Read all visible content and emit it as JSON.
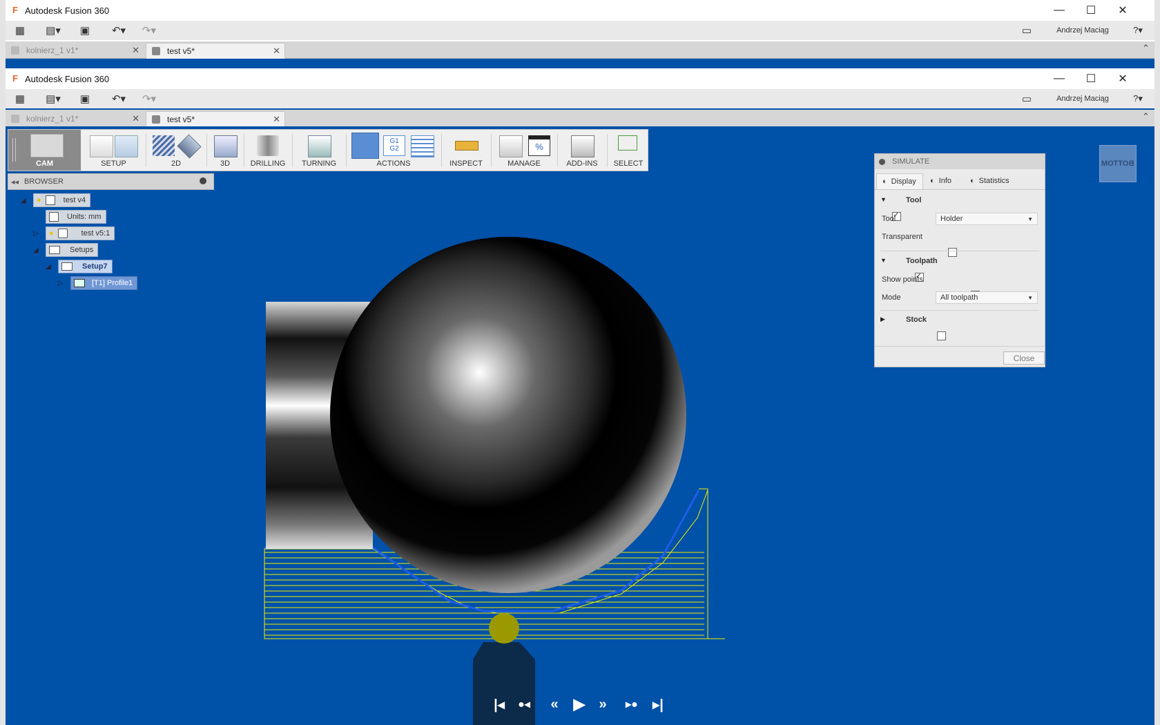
{
  "back_window": {
    "title": "Autodesk Fusion 360",
    "user": "Andrzej Maciąg",
    "tabs": [
      {
        "label": "kolnierz_1 v1*"
      },
      {
        "label": "test v5*"
      }
    ]
  },
  "front_window": {
    "title": "Autodesk Fusion 360",
    "user": "Andrzej Maciąg",
    "tabs": [
      {
        "label": "kolnierz_1 v1*"
      },
      {
        "label": "test v5*"
      }
    ]
  },
  "toolbar": {
    "workspace": "CAM",
    "groups": {
      "setup": "SETUP",
      "2d": "2D",
      "3d": "3D",
      "drilling": "DRILLING",
      "turning": "TURNING",
      "actions": "ACTIONS",
      "inspect": "INSPECT",
      "manage": "MANAGE",
      "addins": "ADD-INS",
      "select": "SELECT"
    },
    "g_code": "G1\nG2"
  },
  "browser": {
    "title": "BROWSER",
    "nodes": {
      "root": "test v4",
      "units": "Units: mm",
      "component": "test v5:1",
      "setups": "Setups",
      "setup7": "Setup7",
      "profile": "[T1] Profile1"
    }
  },
  "viewcube": {
    "face": "BOTTOM"
  },
  "simulate": {
    "title": "SIMULATE",
    "tabs": {
      "display": "Display",
      "info": "Info",
      "statistics": "Statistics"
    },
    "tool_section": "Tool",
    "tool_label": "Tool",
    "tool_value": "Holder",
    "transparent_label": "Transparent",
    "toolpath_section": "Toolpath",
    "show_points_label": "Show points",
    "mode_label": "Mode",
    "mode_value": "All toolpath",
    "stock_section": "Stock",
    "close": "Close",
    "tool_checked": true,
    "transparent_checked": false,
    "toolpath_checked": true,
    "show_points_checked": false,
    "stock_checked": false
  },
  "colors": {
    "viewport_bg": "#0051a8",
    "toolpath_yellow": "#f0f000",
    "toolpath_blue": "#1e5de8",
    "tool_tip": "#9a9a00"
  }
}
